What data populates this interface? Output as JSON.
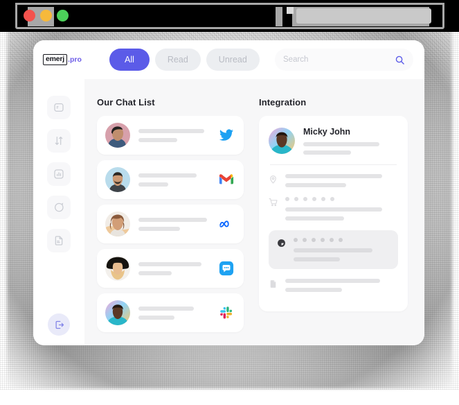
{
  "browser": {
    "traffic_lights": [
      {
        "name": "close",
        "color": "#f4524d"
      },
      {
        "name": "minimize",
        "color": "#f6b93b"
      },
      {
        "name": "maximize",
        "color": "#4cd05a"
      }
    ],
    "address_bar_value": ""
  },
  "app": {
    "logo": {
      "mark": "emerj",
      "suffix": ".pro",
      "accent": "#6c5ce7"
    },
    "tabs": [
      {
        "label": "All",
        "active": true
      },
      {
        "label": "Read",
        "active": false
      },
      {
        "label": "Unread",
        "active": false
      }
    ],
    "active_tab_color": "#5B5BE8",
    "search": {
      "value": "",
      "placeholder": "Search",
      "icon": "search-icon"
    }
  },
  "sidebar": {
    "items": [
      {
        "icon": "chat-box-icon",
        "label": ""
      },
      {
        "icon": "transfer-arrows-icon",
        "label": ""
      },
      {
        "icon": "analytics-icon",
        "label": ""
      },
      {
        "icon": "chat-bubble-icon",
        "label": ""
      },
      {
        "icon": "document-icon",
        "label": ""
      }
    ],
    "logout": {
      "icon": "logout-icon",
      "label": ""
    }
  },
  "chat_list": {
    "title": "Our Chat List",
    "rows": [
      {
        "avatar": "avatar-man-pink",
        "channel": "twitter-icon",
        "line_widths": [
          "88%",
          "52%"
        ]
      },
      {
        "avatar": "avatar-man-blue",
        "channel": "gmail-icon",
        "line_widths": [
          "78%",
          "40%"
        ]
      },
      {
        "avatar": "avatar-woman-curly",
        "channel": "meta-icon",
        "line_widths": [
          "92%",
          "56%"
        ]
      },
      {
        "avatar": "avatar-woman-hat",
        "channel": "messenger-sms-icon",
        "line_widths": [
          "84%",
          "44%"
        ]
      },
      {
        "avatar": "avatar-man-colorful",
        "channel": "slack-icon",
        "line_widths": [
          "74%",
          "48%"
        ]
      }
    ]
  },
  "integration": {
    "title": "Integration",
    "person": {
      "name": "Micky John",
      "avatar": "avatar-man-colorful",
      "line_widths": [
        "80%",
        "50%"
      ]
    },
    "blocks": [
      {
        "icon": "location-pin-icon",
        "dots": 0,
        "highlighted": false,
        "line_widths": [
          "86%",
          "54%"
        ]
      },
      {
        "icon": "shopping-cart-icon",
        "dots": 6,
        "highlighted": false,
        "line_widths": [
          "86%",
          "52%"
        ]
      },
      {
        "icon": "clock-icon",
        "dots": 6,
        "highlighted": true,
        "line_widths": [
          "82%",
          "48%"
        ]
      },
      {
        "icon": "file-document-icon",
        "dots": 0,
        "highlighted": false,
        "line_widths": [
          "84%",
          "50%"
        ]
      }
    ]
  }
}
